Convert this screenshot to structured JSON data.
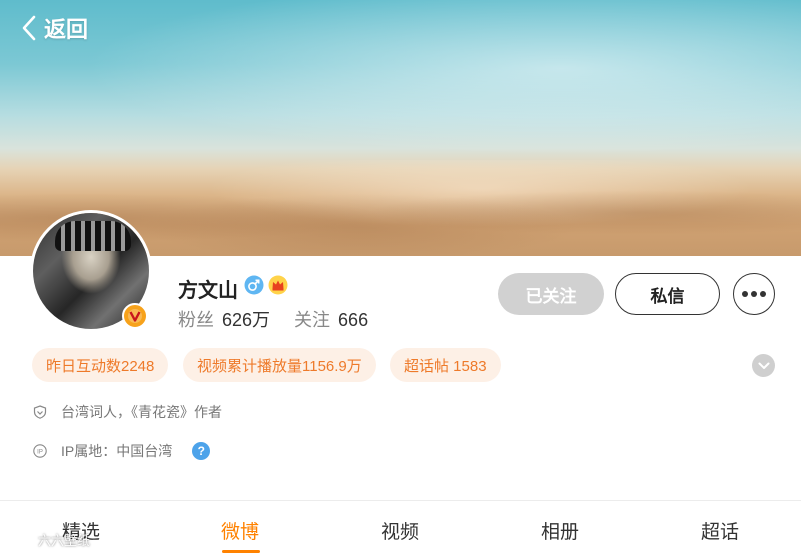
{
  "header": {
    "back_label": "返回"
  },
  "profile": {
    "name": "方文山",
    "gender_icon": "male-icon",
    "badge_icon": "crown-icon",
    "verified_icon": "v-badge-icon",
    "followers_label": "粉丝",
    "followers_value": "626万",
    "following_label": "关注",
    "following_value": "666"
  },
  "actions": {
    "followed_label": "已关注",
    "message_label": "私信",
    "more_icon": "more-dots-icon"
  },
  "tags": [
    {
      "label": "昨日互动数2248"
    },
    {
      "label": "视频累计播放量1156.9万"
    },
    {
      "label": "超话帖 1583"
    }
  ],
  "info": {
    "description": "台湾词人，《青花瓷》作者",
    "ip_location": "IP属地：中国台湾",
    "help_icon_text": "?"
  },
  "tabs": [
    {
      "label": "精选"
    },
    {
      "label": "微博"
    },
    {
      "label": "视频"
    },
    {
      "label": "相册"
    },
    {
      "label": "超话"
    }
  ],
  "active_tab": "微博",
  "watermark": {
    "text": "六六壁纸"
  },
  "colors": {
    "accent": "#ff8200",
    "tag_text": "#ee7a2a",
    "tag_bg": "#fdf0e6",
    "followed_bg": "#d1d1d1",
    "help_icon": "#4da3ea",
    "verified_badge": "#f7a21b"
  }
}
